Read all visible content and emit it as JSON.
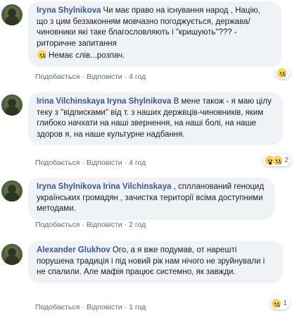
{
  "comments": [
    {
      "author": "Iryna Shylnikova",
      "mention": "",
      "text": "Чи має право на існування народ , Націю, що з цим беззаконням мовчазно погоджується, держава/чиновники які таке благословляють і \"кришують\"??? - риторичне запитання",
      "extra": "Немає слів...розпач.",
      "extra_icon": "sad-cry-emoji-icon",
      "like": "Подобається",
      "reply": "Відповісти",
      "time": "4 год",
      "reactions": {
        "icons": [
          "sad-emoji-icon"
        ],
        "count": ""
      }
    },
    {
      "author": "Irina Vilchinskaya",
      "mention": "Iryna Shylnikova",
      "text": "В мене також - я маю цілу теку з \"відписками\" від т. з наших держвців-чиновників, яким глибоко начхати на наші звернення, на наші болі, на наше здоров я, на наше культурне надбання.",
      "extra": "",
      "like": "Подобається",
      "reply": "Відповісти",
      "time": "4 год",
      "reactions": {
        "icons": [
          "wow-emoji-icon",
          "sad-emoji-icon"
        ],
        "count": "2"
      }
    },
    {
      "author": "Iryna Shylnikova",
      "mention": "Irina Vilchinskaya",
      "text": ", сплланований геноцид українських громадян , зачистка території всіма доступними методами.",
      "extra": "",
      "like": "Подобається",
      "reply": "Відповісти",
      "time": "2 год",
      "reactions": {
        "icons": [],
        "count": ""
      }
    },
    {
      "author": "Alexander Glukhov",
      "mention": "",
      "text": "Ого, а я вже подумав, от нарешті порушена традиція і під новий рік нам нічого не зруйнували і не спалили. Але мафія працює системно, як завжди.",
      "extra": "",
      "like": "Подобається",
      "reply": "Відповісти",
      "time": "1 год",
      "reactions": {
        "icons": [
          "sad-emoji-icon"
        ],
        "count": "1"
      }
    }
  ]
}
